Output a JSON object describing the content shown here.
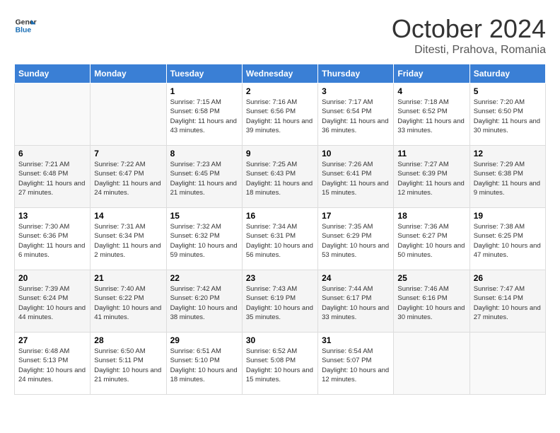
{
  "logo": {
    "text_general": "General",
    "text_blue": "Blue"
  },
  "title": "October 2024",
  "location": "Ditesti, Prahova, Romania",
  "columns": [
    "Sunday",
    "Monday",
    "Tuesday",
    "Wednesday",
    "Thursday",
    "Friday",
    "Saturday"
  ],
  "weeks": [
    [
      {
        "day": "",
        "sunrise": "",
        "sunset": "",
        "daylight": ""
      },
      {
        "day": "",
        "sunrise": "",
        "sunset": "",
        "daylight": ""
      },
      {
        "day": "1",
        "sunrise": "Sunrise: 7:15 AM",
        "sunset": "Sunset: 6:58 PM",
        "daylight": "Daylight: 11 hours and 43 minutes."
      },
      {
        "day": "2",
        "sunrise": "Sunrise: 7:16 AM",
        "sunset": "Sunset: 6:56 PM",
        "daylight": "Daylight: 11 hours and 39 minutes."
      },
      {
        "day": "3",
        "sunrise": "Sunrise: 7:17 AM",
        "sunset": "Sunset: 6:54 PM",
        "daylight": "Daylight: 11 hours and 36 minutes."
      },
      {
        "day": "4",
        "sunrise": "Sunrise: 7:18 AM",
        "sunset": "Sunset: 6:52 PM",
        "daylight": "Daylight: 11 hours and 33 minutes."
      },
      {
        "day": "5",
        "sunrise": "Sunrise: 7:20 AM",
        "sunset": "Sunset: 6:50 PM",
        "daylight": "Daylight: 11 hours and 30 minutes."
      }
    ],
    [
      {
        "day": "6",
        "sunrise": "Sunrise: 7:21 AM",
        "sunset": "Sunset: 6:48 PM",
        "daylight": "Daylight: 11 hours and 27 minutes."
      },
      {
        "day": "7",
        "sunrise": "Sunrise: 7:22 AM",
        "sunset": "Sunset: 6:47 PM",
        "daylight": "Daylight: 11 hours and 24 minutes."
      },
      {
        "day": "8",
        "sunrise": "Sunrise: 7:23 AM",
        "sunset": "Sunset: 6:45 PM",
        "daylight": "Daylight: 11 hours and 21 minutes."
      },
      {
        "day": "9",
        "sunrise": "Sunrise: 7:25 AM",
        "sunset": "Sunset: 6:43 PM",
        "daylight": "Daylight: 11 hours and 18 minutes."
      },
      {
        "day": "10",
        "sunrise": "Sunrise: 7:26 AM",
        "sunset": "Sunset: 6:41 PM",
        "daylight": "Daylight: 11 hours and 15 minutes."
      },
      {
        "day": "11",
        "sunrise": "Sunrise: 7:27 AM",
        "sunset": "Sunset: 6:39 PM",
        "daylight": "Daylight: 11 hours and 12 minutes."
      },
      {
        "day": "12",
        "sunrise": "Sunrise: 7:29 AM",
        "sunset": "Sunset: 6:38 PM",
        "daylight": "Daylight: 11 hours and 9 minutes."
      }
    ],
    [
      {
        "day": "13",
        "sunrise": "Sunrise: 7:30 AM",
        "sunset": "Sunset: 6:36 PM",
        "daylight": "Daylight: 11 hours and 6 minutes."
      },
      {
        "day": "14",
        "sunrise": "Sunrise: 7:31 AM",
        "sunset": "Sunset: 6:34 PM",
        "daylight": "Daylight: 11 hours and 2 minutes."
      },
      {
        "day": "15",
        "sunrise": "Sunrise: 7:32 AM",
        "sunset": "Sunset: 6:32 PM",
        "daylight": "Daylight: 10 hours and 59 minutes."
      },
      {
        "day": "16",
        "sunrise": "Sunrise: 7:34 AM",
        "sunset": "Sunset: 6:31 PM",
        "daylight": "Daylight: 10 hours and 56 minutes."
      },
      {
        "day": "17",
        "sunrise": "Sunrise: 7:35 AM",
        "sunset": "Sunset: 6:29 PM",
        "daylight": "Daylight: 10 hours and 53 minutes."
      },
      {
        "day": "18",
        "sunrise": "Sunrise: 7:36 AM",
        "sunset": "Sunset: 6:27 PM",
        "daylight": "Daylight: 10 hours and 50 minutes."
      },
      {
        "day": "19",
        "sunrise": "Sunrise: 7:38 AM",
        "sunset": "Sunset: 6:25 PM",
        "daylight": "Daylight: 10 hours and 47 minutes."
      }
    ],
    [
      {
        "day": "20",
        "sunrise": "Sunrise: 7:39 AM",
        "sunset": "Sunset: 6:24 PM",
        "daylight": "Daylight: 10 hours and 44 minutes."
      },
      {
        "day": "21",
        "sunrise": "Sunrise: 7:40 AM",
        "sunset": "Sunset: 6:22 PM",
        "daylight": "Daylight: 10 hours and 41 minutes."
      },
      {
        "day": "22",
        "sunrise": "Sunrise: 7:42 AM",
        "sunset": "Sunset: 6:20 PM",
        "daylight": "Daylight: 10 hours and 38 minutes."
      },
      {
        "day": "23",
        "sunrise": "Sunrise: 7:43 AM",
        "sunset": "Sunset: 6:19 PM",
        "daylight": "Daylight: 10 hours and 35 minutes."
      },
      {
        "day": "24",
        "sunrise": "Sunrise: 7:44 AM",
        "sunset": "Sunset: 6:17 PM",
        "daylight": "Daylight: 10 hours and 33 minutes."
      },
      {
        "day": "25",
        "sunrise": "Sunrise: 7:46 AM",
        "sunset": "Sunset: 6:16 PM",
        "daylight": "Daylight: 10 hours and 30 minutes."
      },
      {
        "day": "26",
        "sunrise": "Sunrise: 7:47 AM",
        "sunset": "Sunset: 6:14 PM",
        "daylight": "Daylight: 10 hours and 27 minutes."
      }
    ],
    [
      {
        "day": "27",
        "sunrise": "Sunrise: 6:48 AM",
        "sunset": "Sunset: 5:13 PM",
        "daylight": "Daylight: 10 hours and 24 minutes."
      },
      {
        "day": "28",
        "sunrise": "Sunrise: 6:50 AM",
        "sunset": "Sunset: 5:11 PM",
        "daylight": "Daylight: 10 hours and 21 minutes."
      },
      {
        "day": "29",
        "sunrise": "Sunrise: 6:51 AM",
        "sunset": "Sunset: 5:10 PM",
        "daylight": "Daylight: 10 hours and 18 minutes."
      },
      {
        "day": "30",
        "sunrise": "Sunrise: 6:52 AM",
        "sunset": "Sunset: 5:08 PM",
        "daylight": "Daylight: 10 hours and 15 minutes."
      },
      {
        "day": "31",
        "sunrise": "Sunrise: 6:54 AM",
        "sunset": "Sunset: 5:07 PM",
        "daylight": "Daylight: 10 hours and 12 minutes."
      },
      {
        "day": "",
        "sunrise": "",
        "sunset": "",
        "daylight": ""
      },
      {
        "day": "",
        "sunrise": "",
        "sunset": "",
        "daylight": ""
      }
    ]
  ]
}
